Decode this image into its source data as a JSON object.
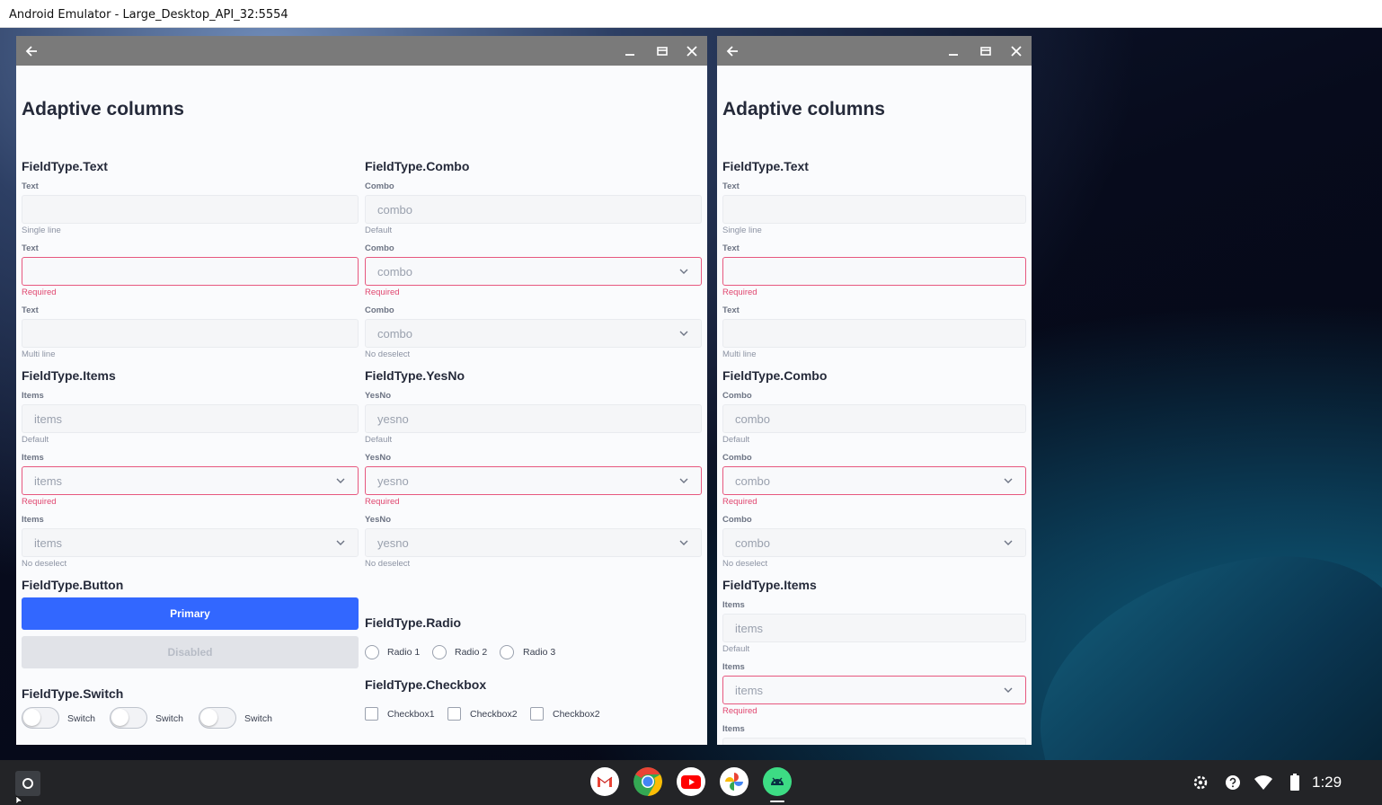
{
  "emulator": {
    "title": "Android Emulator - Large_Desktop_API_32:5554"
  },
  "page_title": "Adaptive columns",
  "labels": {
    "text": "Text",
    "combo": "Combo",
    "items": "Items",
    "yesno": "YesNo",
    "single_line": "Single line",
    "multi_line": "Multi line",
    "default": "Default",
    "required": "Required",
    "no_deselect": "No deselect"
  },
  "values": {
    "combo": "combo",
    "items": "items",
    "yesno": "yesno"
  },
  "sections": {
    "text": "FieldType.Text",
    "combo": "FieldType.Combo",
    "items": "FieldType.Items",
    "yesno": "FieldType.YesNo",
    "button": "FieldType.Button",
    "radio": "FieldType.Radio",
    "switch": "FieldType.Switch",
    "checkbox": "FieldType.Checkbox"
  },
  "buttons": {
    "primary": "Primary",
    "disabled": "Disabled"
  },
  "radios": [
    "Radio 1",
    "Radio 2",
    "Radio 3"
  ],
  "checkboxes": [
    "Checkbox1",
    "Checkbox2",
    "Checkbox2"
  ],
  "switches": [
    "Switch",
    "Switch",
    "Switch"
  ],
  "taskbar": {
    "apps": [
      "gmail-icon",
      "chrome-icon",
      "youtube-icon",
      "photos-icon",
      "android-app-icon"
    ],
    "time": "1:29"
  },
  "colors": {
    "accent": "#3267ff",
    "error": "#e7587f",
    "caption_bar": "#7a7a7a"
  }
}
